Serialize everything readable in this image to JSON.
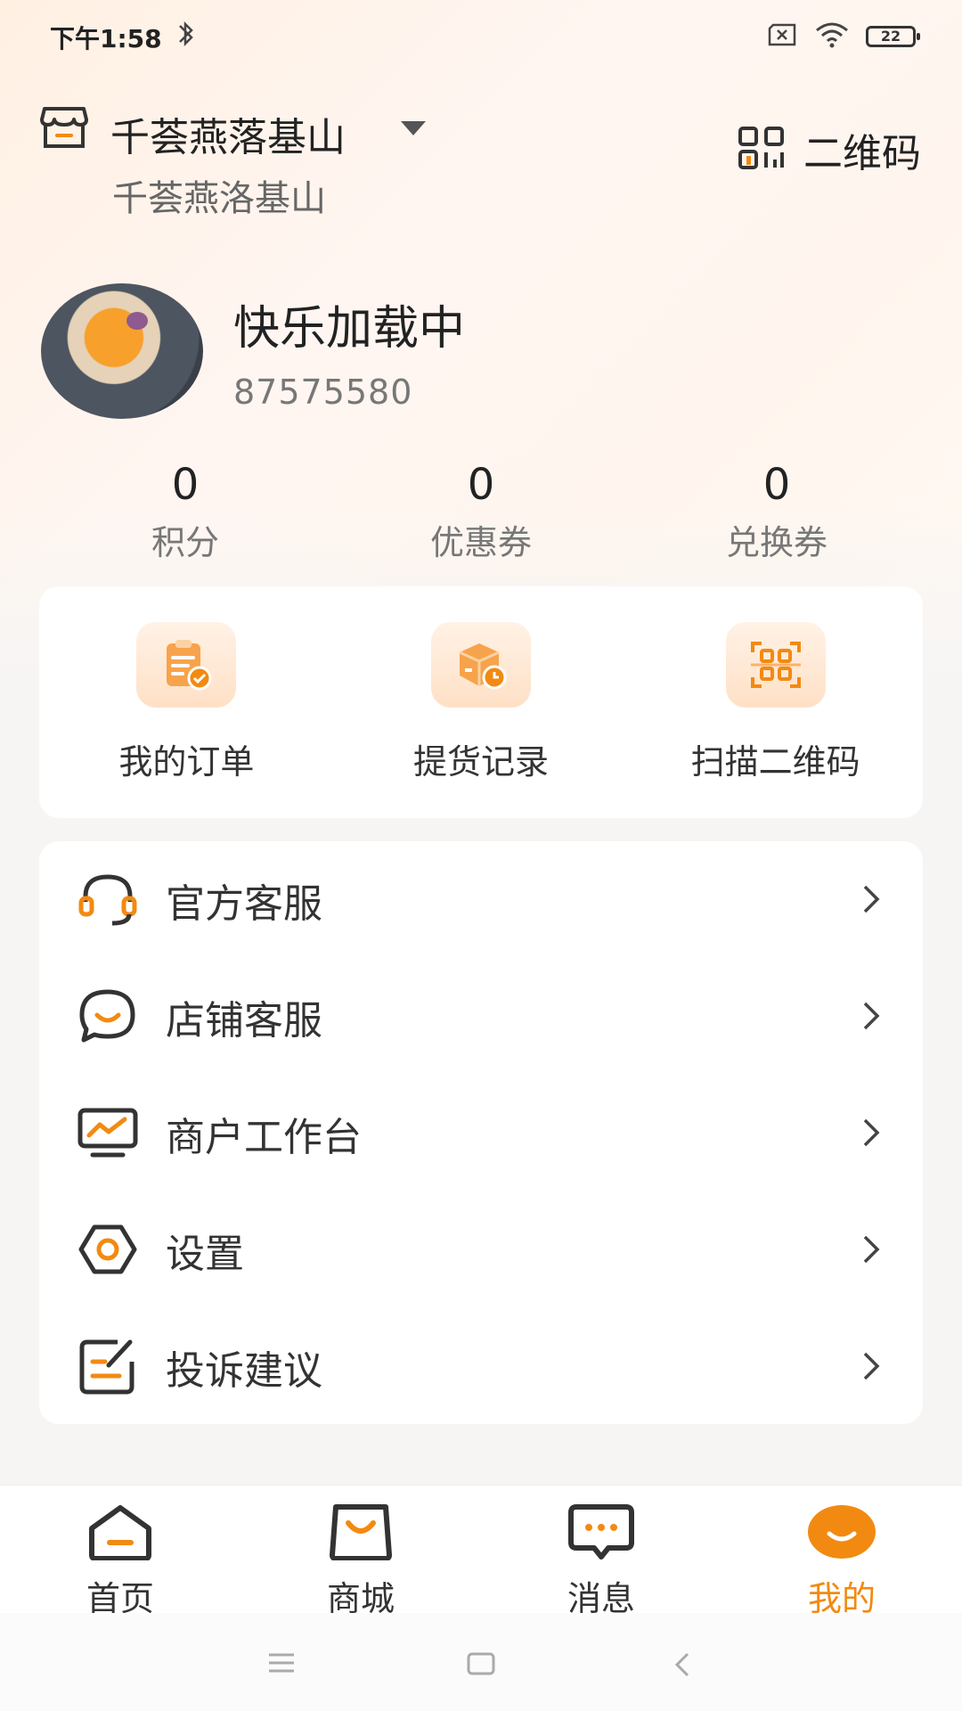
{
  "status_bar": {
    "time": "下午1:58",
    "battery": "22"
  },
  "store": {
    "name": "千荟燕落基山",
    "subtitle": "千荟燕洛基山",
    "qr_label": "二维码"
  },
  "profile": {
    "nickname": "快乐加载中",
    "user_id": "87575580"
  },
  "stats": [
    {
      "value": "0",
      "label": "积分"
    },
    {
      "value": "0",
      "label": "优惠券"
    },
    {
      "value": "0",
      "label": "兑换券"
    }
  ],
  "quick_actions": [
    {
      "label": "我的订单",
      "icon": "order-clipboard-icon"
    },
    {
      "label": "提货记录",
      "icon": "package-clock-icon"
    },
    {
      "label": "扫描二维码",
      "icon": "scan-qr-icon"
    }
  ],
  "menu": [
    {
      "label": "官方客服",
      "icon": "headset-icon"
    },
    {
      "label": "店铺客服",
      "icon": "chat-smile-icon"
    },
    {
      "label": "商户工作台",
      "icon": "monitor-chart-icon"
    },
    {
      "label": "设置",
      "icon": "settings-hexagon-icon"
    },
    {
      "label": "投诉建议",
      "icon": "edit-note-icon"
    }
  ],
  "tabs": [
    {
      "label": "首页",
      "icon": "home-icon"
    },
    {
      "label": "商城",
      "icon": "shopping-bag-icon"
    },
    {
      "label": "消息",
      "icon": "message-icon"
    },
    {
      "label": "我的",
      "icon": "profile-smile-icon",
      "active": true
    }
  ],
  "colors": {
    "accent": "#f28a12",
    "text": "#333333",
    "muted": "#777777",
    "background": "#f6f5f4"
  }
}
